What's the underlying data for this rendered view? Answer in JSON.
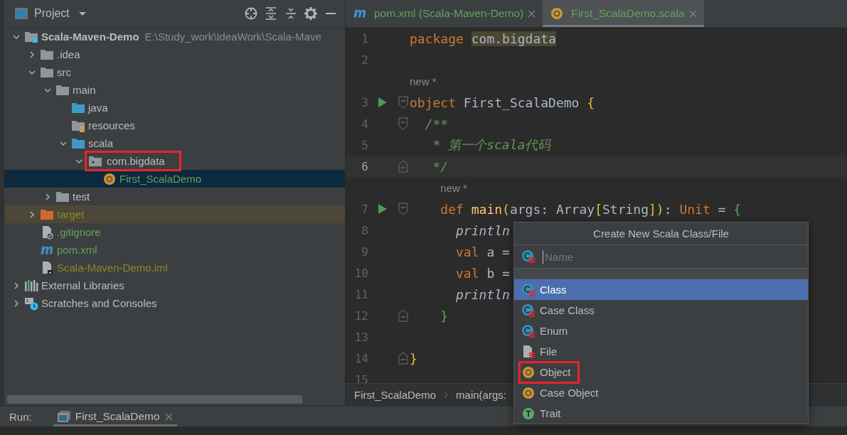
{
  "project_panel": {
    "title": "Project",
    "tree": [
      {
        "name": "Scala-Maven-Demo",
        "path": "E:\\Study_work\\IdeaWork\\Scala-Mave",
        "kind": "module",
        "color": "#bbbbbb",
        "expanded": true,
        "selected": false,
        "children": [
          {
            "name": ".idea",
            "kind": "folder",
            "color": "#bbbbbb",
            "expanded": false,
            "selected": false
          },
          {
            "name": "src",
            "kind": "folder",
            "color": "#bbbbbb",
            "expanded": true,
            "selected": false,
            "children": [
              {
                "name": "main",
                "kind": "folder",
                "color": "#bbbbbb",
                "expanded": true,
                "selected": false,
                "children": [
                  {
                    "name": "java",
                    "kind": "source-folder",
                    "color": "#bbbbbb",
                    "selected": false
                  },
                  {
                    "name": "resources",
                    "kind": "resources-folder",
                    "color": "#bbbbbb",
                    "selected": false
                  },
                  {
                    "name": "scala",
                    "kind": "source-folder",
                    "color": "#bbbbbb",
                    "expanded": true,
                    "selected": false,
                    "children": [
                      {
                        "name": "com.bigdata",
                        "kind": "package",
                        "color": "#bbbbbb",
                        "expanded": true,
                        "selected": false,
                        "marked": true,
                        "children": [
                          {
                            "name": "First_ScalaDemo",
                            "kind": "object",
                            "color": "#62a35b",
                            "selected": true
                          }
                        ]
                      }
                    ]
                  }
                ]
              },
              {
                "name": "test",
                "kind": "folder",
                "color": "#bbbbbb",
                "expanded": false,
                "selected": false
              }
            ]
          },
          {
            "name": "target",
            "kind": "excluded-folder",
            "color": "#8d8a23",
            "expanded": false,
            "selected": false
          },
          {
            "name": ".gitignore",
            "kind": "ignore-file",
            "color": "#62a35b",
            "selected": false
          },
          {
            "name": "pom.xml",
            "kind": "maven",
            "color": "#62a35b",
            "selected": false
          },
          {
            "name": "Scala-Maven-Demo.iml",
            "kind": "module-file",
            "color": "#8d8a23",
            "selected": false
          }
        ]
      },
      {
        "name": "External Libraries",
        "kind": "libraries",
        "color": "#bbbbbb",
        "expanded": false,
        "selected": false
      },
      {
        "name": "Scratches and Consoles",
        "kind": "scratches",
        "color": "#bbbbbb",
        "expanded": false,
        "selected": false
      }
    ]
  },
  "editor": {
    "tabs": [
      {
        "label": "pom.xml (Scala-Maven-Demo)",
        "kind": "maven",
        "selected": false
      },
      {
        "label": "First_ScalaDemo.scala",
        "kind": "object",
        "selected": true
      }
    ],
    "lines": [
      {
        "number": "1",
        "kind": "plain",
        "tokens": [
          {
            "text": "package ",
            "kind": "keyword"
          },
          {
            "text": "com.bigdata",
            "kind": "highlight"
          }
        ]
      },
      {
        "number": "2",
        "kind": "plain"
      },
      {
        "number": "3",
        "hint": "new *",
        "run": true,
        "kind": "fold-start",
        "tokens": [
          {
            "text": "object ",
            "kind": "keyword"
          },
          {
            "text": "First_ScalaDemo ",
            "kind": "plain"
          },
          {
            "text": "{",
            "kind": "brace"
          }
        ]
      },
      {
        "number": "4",
        "kind": "fold-start",
        "tokens": [
          {
            "text": "  /**",
            "kind": "doc"
          }
        ]
      },
      {
        "number": "5",
        "kind": "plain",
        "tokens": [
          {
            "text": "   * 第一个scala代码",
            "kind": "doc"
          }
        ]
      },
      {
        "number": "6",
        "current": true,
        "kind": "fold-end",
        "tokens": [
          {
            "text": "   */",
            "kind": "doc"
          }
        ]
      },
      {
        "number": "7",
        "hint": "new *",
        "run": true,
        "kind": "fold-start",
        "tokens": [
          {
            "text": "    def ",
            "kind": "keyword"
          },
          {
            "text": "main",
            "kind": "function"
          },
          {
            "text": "(",
            "kind": "brace"
          },
          {
            "text": "args: Array",
            "kind": "plain"
          },
          {
            "text": "[",
            "kind": "brace"
          },
          {
            "text": "String",
            "kind": "plain"
          },
          {
            "text": "])",
            "kind": "brace"
          },
          {
            "text": ": ",
            "kind": "plain"
          },
          {
            "text": "Unit",
            "kind": "keyword"
          },
          {
            "text": " = ",
            "kind": "plain"
          },
          {
            "text": "{",
            "kind": "brace2"
          }
        ]
      },
      {
        "number": "8",
        "kind": "plain",
        "tokens": [
          {
            "text": "      println",
            "kind": "call"
          }
        ]
      },
      {
        "number": "9",
        "kind": "plain",
        "tokens": [
          {
            "text": "      val ",
            "kind": "keyword"
          },
          {
            "text": "a =",
            "kind": "plain"
          }
        ]
      },
      {
        "number": "10",
        "kind": "plain",
        "tokens": [
          {
            "text": "      val ",
            "kind": "keyword"
          },
          {
            "text": "b =",
            "kind": "plain"
          }
        ]
      },
      {
        "number": "11",
        "kind": "plain",
        "tokens": [
          {
            "text": "      println",
            "kind": "call"
          }
        ]
      },
      {
        "number": "12",
        "kind": "fold-end",
        "tokens": [
          {
            "text": "    }",
            "kind": "brace2"
          }
        ]
      },
      {
        "number": "13",
        "kind": "plain"
      },
      {
        "number": "14",
        "kind": "fold-end",
        "tokens": [
          {
            "text": "}",
            "kind": "brace"
          }
        ]
      },
      {
        "number": "15",
        "kind": "plain"
      }
    ],
    "breadcrumbs": [
      "First_ScalaDemo",
      "main(args:"
    ]
  },
  "popup": {
    "title": "Create New Scala Class/File",
    "field": {
      "placeholder": "Name"
    },
    "items": [
      {
        "label": "Class",
        "kind": "class",
        "selected": true,
        "marked": false
      },
      {
        "label": "Case Class",
        "kind": "case-class",
        "selected": false,
        "marked": false
      },
      {
        "label": "Enum",
        "kind": "enum",
        "selected": false,
        "marked": false
      },
      {
        "label": "File",
        "kind": "file",
        "selected": false,
        "marked": false
      },
      {
        "label": "Object",
        "kind": "object",
        "selected": false,
        "marked": true
      },
      {
        "label": "Case Object",
        "kind": "case-object",
        "selected": false,
        "marked": false
      },
      {
        "label": "Trait",
        "kind": "trait",
        "selected": false,
        "marked": false
      }
    ]
  },
  "run_bar": {
    "label": "Run:",
    "tabs": [
      {
        "label": "First_ScalaDemo",
        "selected": true
      }
    ]
  }
}
